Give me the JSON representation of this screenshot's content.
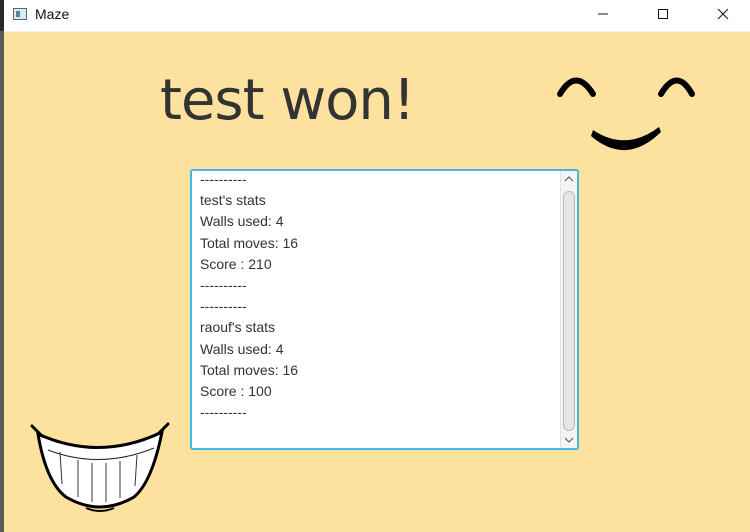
{
  "window": {
    "title": "Maze",
    "controls": {
      "minimize": "minimize",
      "maximize": "maximize",
      "close": "close"
    }
  },
  "main": {
    "heading": "test won!",
    "stats_lines": [
      "----------",
      "test's stats",
      "Walls used: 4",
      "Total moves: 16",
      "Score : 210",
      "----------",
      "----------",
      "raouf's stats",
      "Walls used: 4",
      "Total moves: 16",
      "Score : 100",
      "----------"
    ]
  },
  "colors": {
    "background": "#fde29f",
    "text_area_border": "#43b7e2",
    "heading_text": "#333333"
  },
  "icons": {
    "face": "smiley-face-icon",
    "teeth": "grin-teeth-icon"
  }
}
